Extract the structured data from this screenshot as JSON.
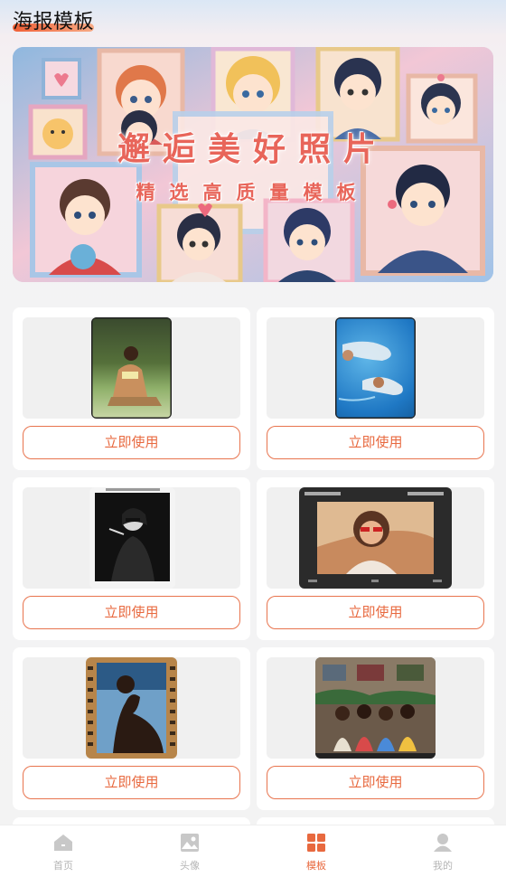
{
  "page": {
    "title": "海报模板"
  },
  "banner": {
    "title": "邂逅美好照片",
    "subtitle": "精选高质量模板"
  },
  "templates": [
    {
      "button_label": "立即使用",
      "photo": "woman-reading-on-grass"
    },
    {
      "button_label": "立即使用",
      "photo": "swimmers-in-pool"
    },
    {
      "button_label": "立即使用",
      "photo": "woman-smoking-bw"
    },
    {
      "button_label": "立即使用",
      "photo": "woman-sunglasses-kodak-portra"
    },
    {
      "button_label": "立即使用",
      "photo": "silhouette-film-strip"
    },
    {
      "button_label": "立即使用",
      "photo": "group-of-women-street"
    }
  ],
  "tabbar": {
    "items": [
      {
        "label": "首页",
        "icon": "home-icon",
        "active": false
      },
      {
        "label": "头像",
        "icon": "image-icon",
        "active": false
      },
      {
        "label": "模板",
        "icon": "grid-icon",
        "active": true
      },
      {
        "label": "我的",
        "icon": "user-icon",
        "active": false
      }
    ]
  },
  "colors": {
    "accent": "#e8693f",
    "inactive": "#b5b5b5"
  }
}
